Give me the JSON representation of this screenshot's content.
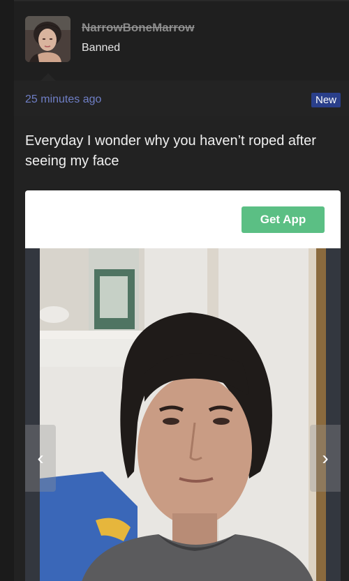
{
  "post": {
    "author": {
      "username": "NarrowBoneMarrow",
      "status": "Banned"
    },
    "timestamp": "25 minutes ago",
    "badge": "New",
    "text": "Everyday I wonder why you haven’t roped after seeing my face"
  },
  "embed": {
    "get_app_label": "Get App",
    "prev_icon": "‹",
    "next_icon": "›"
  },
  "colors": {
    "background": "#222222",
    "username": "#8a8a8a",
    "timestamp": "#6f7fc6",
    "badge": "#2a3f8a",
    "get_app_button": "#5bbf84"
  },
  "icons": {
    "prev": "chevron-left-icon",
    "next": "chevron-right-icon"
  }
}
